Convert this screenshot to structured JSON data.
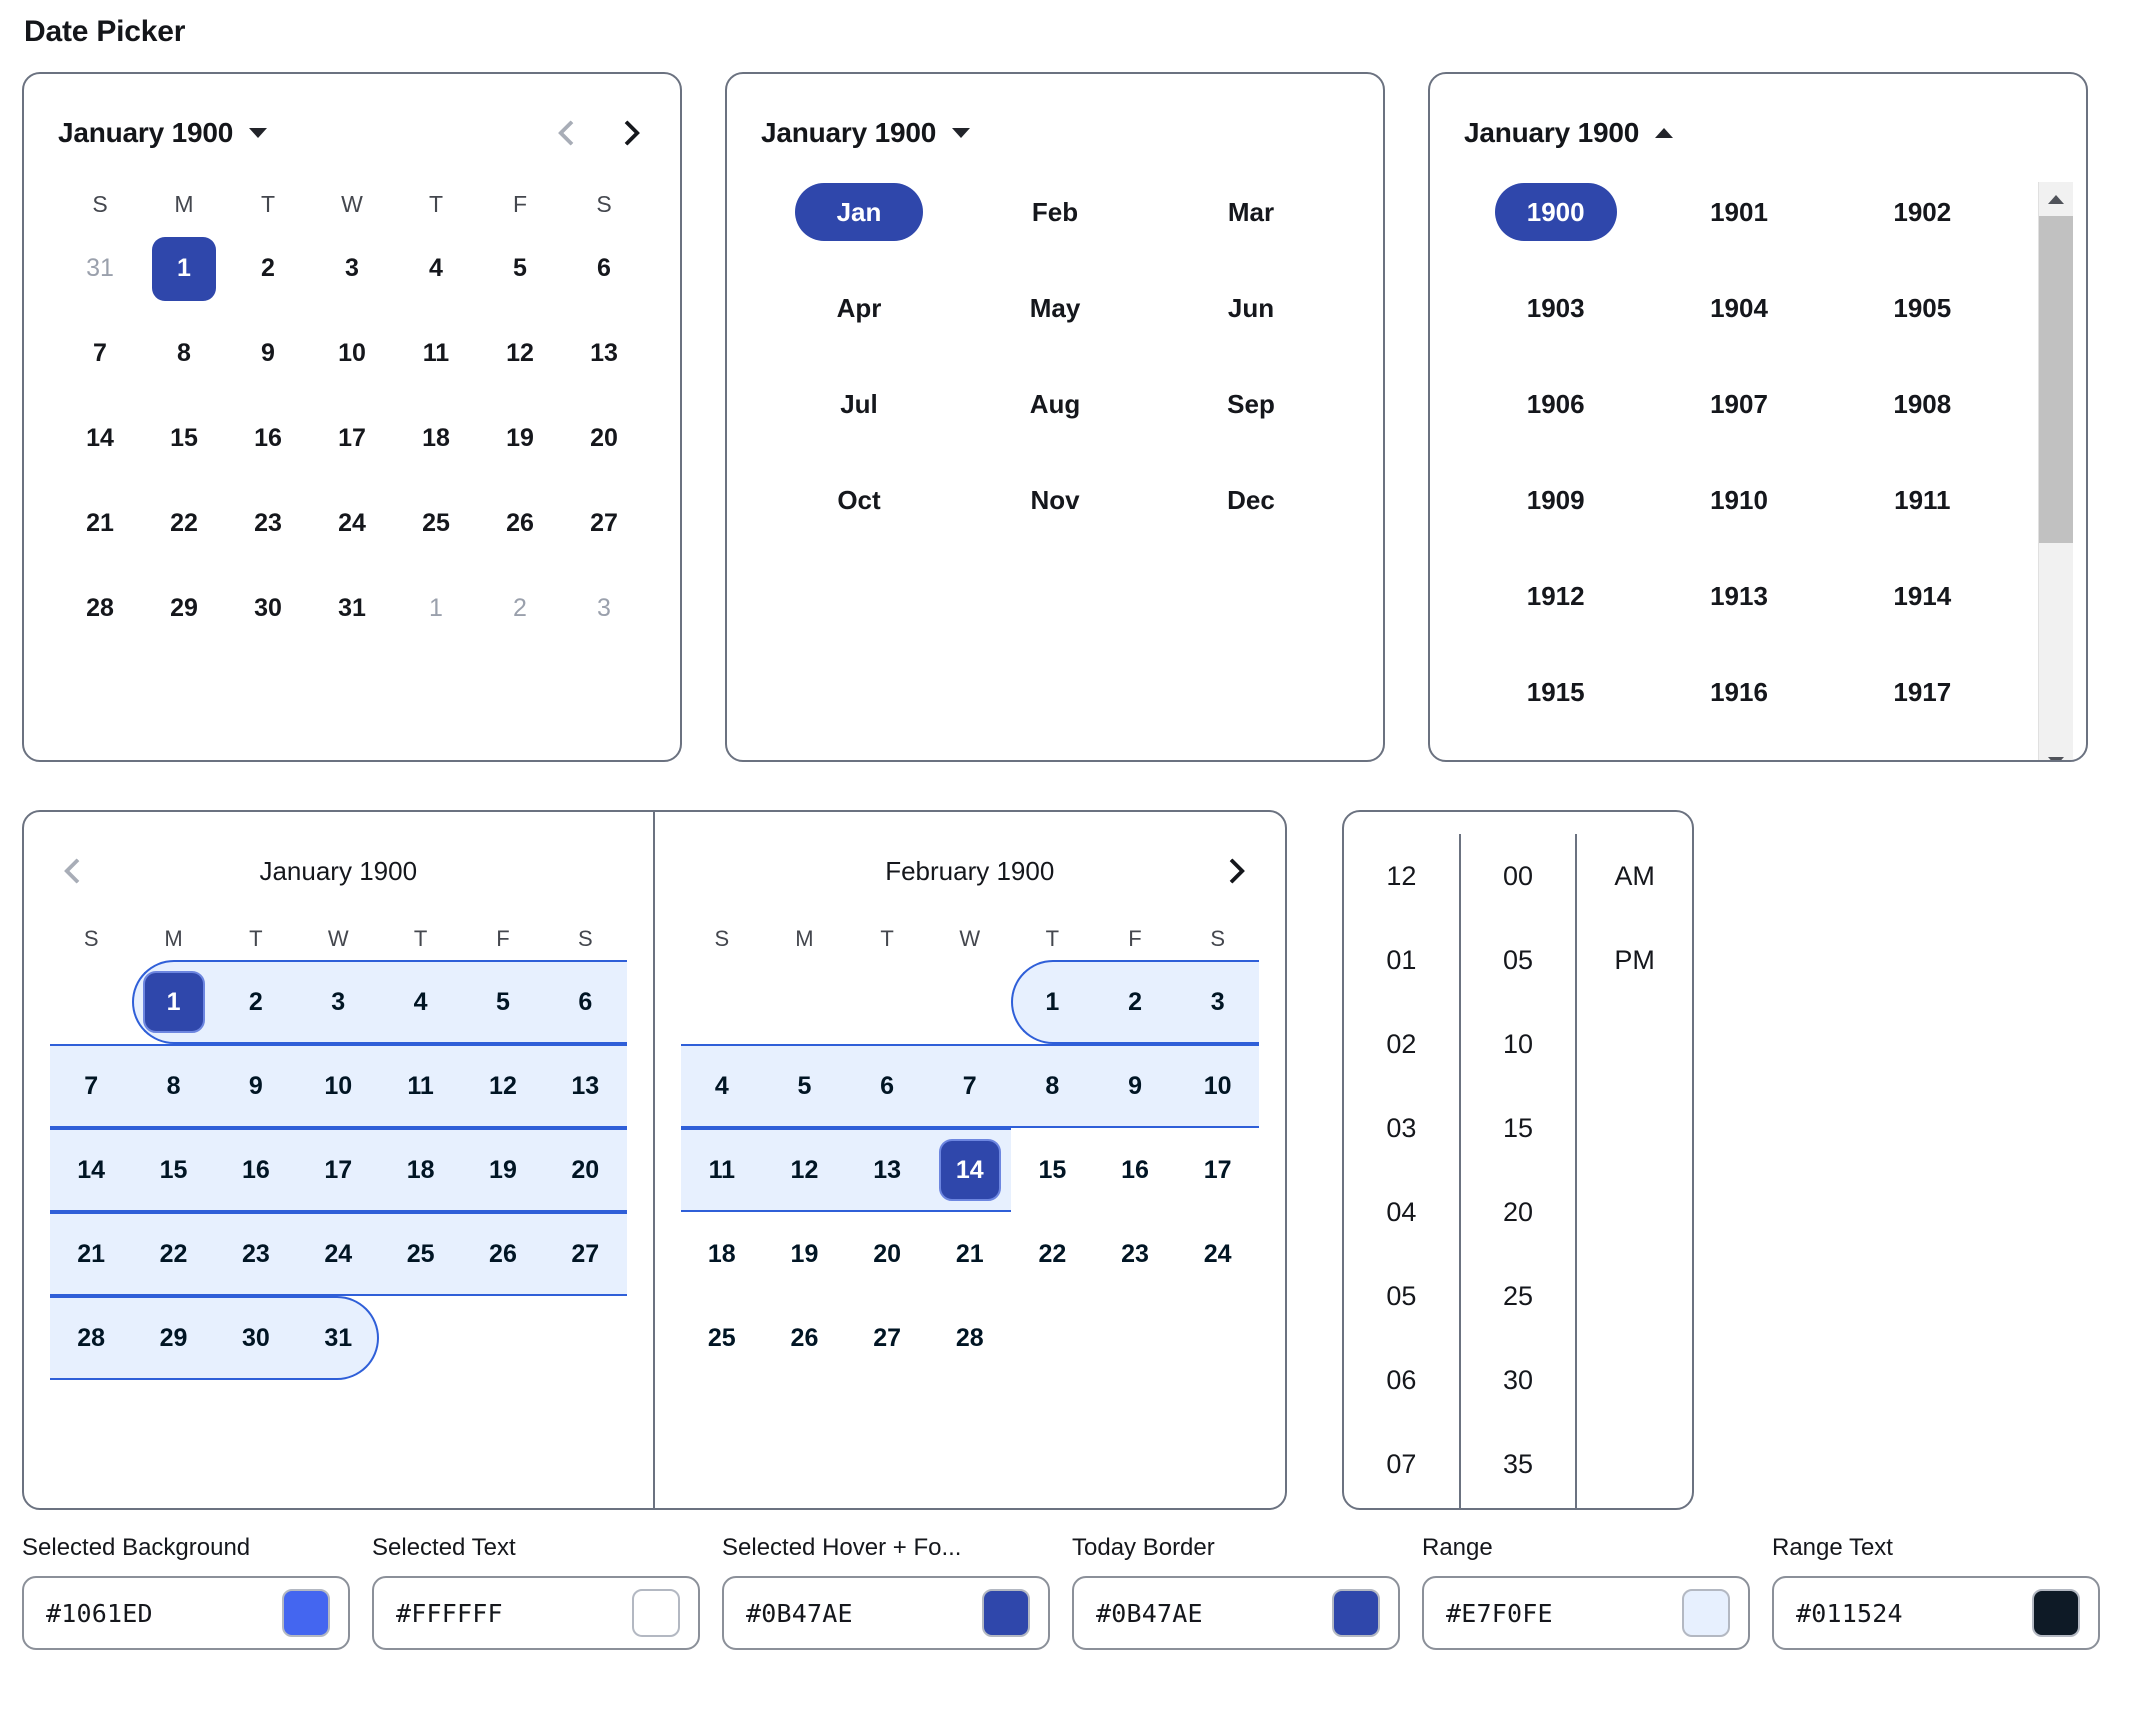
{
  "page": {
    "title": "Date Picker"
  },
  "day_picker": {
    "header_label": "January 1900",
    "caret_icon": "chevron-down-icon",
    "prev_icon": "chevron-left-icon",
    "next_icon": "chevron-right-icon",
    "weekdays": [
      "S",
      "M",
      "T",
      "W",
      "T",
      "F",
      "S"
    ],
    "weeks": [
      [
        {
          "d": "31",
          "muted": true
        },
        {
          "d": "1",
          "selected": true
        },
        {
          "d": "2"
        },
        {
          "d": "3"
        },
        {
          "d": "4"
        },
        {
          "d": "5"
        },
        {
          "d": "6"
        }
      ],
      [
        {
          "d": "7"
        },
        {
          "d": "8"
        },
        {
          "d": "9"
        },
        {
          "d": "10"
        },
        {
          "d": "11"
        },
        {
          "d": "12"
        },
        {
          "d": "13"
        }
      ],
      [
        {
          "d": "14"
        },
        {
          "d": "15"
        },
        {
          "d": "16"
        },
        {
          "d": "17"
        },
        {
          "d": "18"
        },
        {
          "d": "19"
        },
        {
          "d": "20"
        }
      ],
      [
        {
          "d": "21"
        },
        {
          "d": "22"
        },
        {
          "d": "23"
        },
        {
          "d": "24"
        },
        {
          "d": "25"
        },
        {
          "d": "26"
        },
        {
          "d": "27"
        }
      ],
      [
        {
          "d": "28"
        },
        {
          "d": "29"
        },
        {
          "d": "30"
        },
        {
          "d": "31"
        },
        {
          "d": "1",
          "muted": true
        },
        {
          "d": "2",
          "muted": true
        },
        {
          "d": "3",
          "muted": true
        }
      ]
    ]
  },
  "month_picker": {
    "header_label": "January 1900",
    "caret_icon": "chevron-down-icon",
    "months": [
      "Jan",
      "Feb",
      "Mar",
      "Apr",
      "May",
      "Jun",
      "Jul",
      "Aug",
      "Sep",
      "Oct",
      "Nov",
      "Dec"
    ],
    "selected": "Jan"
  },
  "year_picker": {
    "header_label": "January 1900",
    "caret_icon": "chevron-up-icon",
    "scrollbar_up_icon": "triangle-up-icon",
    "scrollbar_down_icon": "triangle-down-icon",
    "years": [
      "1900",
      "1901",
      "1902",
      "1903",
      "1904",
      "1905",
      "1906",
      "1907",
      "1908",
      "1909",
      "1910",
      "1911",
      "1912",
      "1913",
      "1914",
      "1915",
      "1916",
      "1917"
    ],
    "selected": "1900"
  },
  "range_picker": {
    "prev_icon": "chevron-left-icon",
    "next_icon": "chevron-right-icon",
    "left": {
      "title": "January 1900",
      "weekdays": [
        "S",
        "M",
        "T",
        "W",
        "T",
        "F",
        "S"
      ],
      "weeks": [
        {
          "cells": [
            "",
            "1",
            "2",
            "3",
            "4",
            "5",
            "6"
          ],
          "selected": 1,
          "band": {
            "start": 1,
            "end": 6,
            "cap_left": true,
            "cap_right": false
          }
        },
        {
          "cells": [
            "7",
            "8",
            "9",
            "10",
            "11",
            "12",
            "13"
          ],
          "band": {
            "start": 0,
            "end": 6,
            "cap_left": false,
            "cap_right": false
          }
        },
        {
          "cells": [
            "14",
            "15",
            "16",
            "17",
            "18",
            "19",
            "20"
          ],
          "band": {
            "start": 0,
            "end": 6,
            "cap_left": false,
            "cap_right": false
          }
        },
        {
          "cells": [
            "21",
            "22",
            "23",
            "24",
            "25",
            "26",
            "27"
          ],
          "band": {
            "start": 0,
            "end": 6,
            "cap_left": false,
            "cap_right": false
          }
        },
        {
          "cells": [
            "28",
            "29",
            "30",
            "31",
            "",
            "",
            ""
          ],
          "band": {
            "start": 0,
            "end": 3,
            "cap_left": false,
            "cap_right": true
          }
        }
      ]
    },
    "right": {
      "title": "February 1900",
      "weekdays": [
        "S",
        "M",
        "T",
        "W",
        "T",
        "F",
        "S"
      ],
      "weeks": [
        {
          "cells": [
            "",
            "",
            "",
            "",
            "1",
            "2",
            "3"
          ],
          "band": {
            "start": 4,
            "end": 6,
            "cap_left": true,
            "cap_right": false
          }
        },
        {
          "cells": [
            "4",
            "5",
            "6",
            "7",
            "8",
            "9",
            "10"
          ],
          "band": {
            "start": 0,
            "end": 6,
            "cap_left": false,
            "cap_right": false
          }
        },
        {
          "cells": [
            "11",
            "12",
            "13",
            "14",
            "15",
            "16",
            "17"
          ],
          "selected": 3,
          "band": {
            "start": 0,
            "end": 3,
            "cap_left": false,
            "cap_right": false
          }
        },
        {
          "cells": [
            "18",
            "19",
            "20",
            "21",
            "22",
            "23",
            "24"
          ]
        },
        {
          "cells": [
            "25",
            "26",
            "27",
            "28",
            "",
            "",
            ""
          ]
        }
      ]
    }
  },
  "time_picker": {
    "hours": [
      "12",
      "01",
      "02",
      "03",
      "04",
      "05",
      "06",
      "07"
    ],
    "minutes": [
      "00",
      "05",
      "10",
      "15",
      "20",
      "25",
      "30",
      "35"
    ],
    "meridiem": [
      "AM",
      "PM"
    ]
  },
  "controls": [
    {
      "label": "Selected Background",
      "value": "#1061ED",
      "swatch": "#4466f0"
    },
    {
      "label": "Selected Text",
      "value": "#FFFFFF",
      "swatch": "#ffffff"
    },
    {
      "label": "Selected Hover + Fo...",
      "value": "#0B47AE",
      "swatch": "#2f47ab"
    },
    {
      "label": "Today Border",
      "value": "#0B47AE",
      "swatch": "#2f47ab"
    },
    {
      "label": "Range",
      "value": "#E7F0FE",
      "swatch": "#e7f0fe"
    },
    {
      "label": "Range Text",
      "value": "#011524",
      "swatch": "#0e1a26"
    }
  ]
}
